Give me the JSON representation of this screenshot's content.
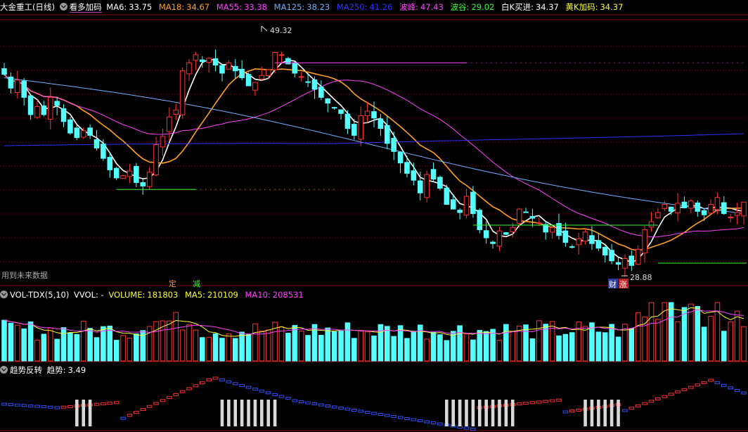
{
  "header": {
    "title": "大金重工(日线)",
    "indicator": "看多加码",
    "ma6_label": "MA6:",
    "ma6_value": "33.75",
    "ma18_label": "MA18:",
    "ma18_value": "34.67",
    "ma55_label": "MA55:",
    "ma55_value": "33.38",
    "ma125_label": "MA125:",
    "ma125_value": "38.23",
    "ma250_label": "MA250:",
    "ma250_value": "41.26",
    "peak_label": "波峰:",
    "peak_value": "47.43",
    "trough_label": "波谷:",
    "trough_value": "29.02",
    "white_k_label": "白K买进:",
    "white_k_value": "34.37",
    "yellow_k_label": "黄K加码:",
    "yellow_k_value": "34.37"
  },
  "main_panel": {
    "future_data_note": "用到未来数据",
    "high_label": "49.32",
    "low_label": "28.88",
    "tag_ding": "定",
    "tag_jian": "减",
    "tag_cai": "财",
    "tag_zhang": "涨"
  },
  "vol_header": {
    "name": "VOL-TDX(5,10)",
    "vvol": "VVOL: -",
    "volume_label": "VOLUME:",
    "volume_value": "181803",
    "ma5_label": "MA5:",
    "ma5_value": "210109",
    "ma10_label": "MA10:",
    "ma10_value": "208531"
  },
  "trend_header": {
    "name": "趋势反转",
    "trend_label": "趋势:",
    "trend_value": "3.49"
  },
  "colors": {
    "up": "#ff3232",
    "down": "#54ffff",
    "ma6": "#ffffff",
    "ma18": "#ffa020",
    "ma55": "#ff40ff",
    "ma125": "#70b0ff",
    "ma250": "#3030ff",
    "peak": "#ff40ff",
    "trough": "#30ff30",
    "white_k": "#ffffff",
    "yellow_k": "#ffff30"
  },
  "chart_data": [
    {
      "type": "candlestick",
      "title": "大金重工(日线)",
      "series_names": [
        "MA6",
        "MA18",
        "MA55",
        "MA125",
        "MA250"
      ],
      "price_range_approx": [
        28.88,
        49.32
      ],
      "annotations": [
        "49.32",
        "28.88",
        "用到未来数据",
        "定",
        "减",
        "财",
        "涨"
      ],
      "close_approx": [
        45.5,
        44.3,
        45.0,
        43.5,
        42.0,
        42.7,
        42.0,
        43.5,
        42.8,
        41.4,
        40.4,
        40.0,
        40.6,
        40.2,
        39.1,
        38.2,
        37.2,
        36.5,
        36.7,
        37.1,
        36.1,
        35.8,
        37.0,
        39.4,
        40.1,
        41.8,
        42.4,
        45.8,
        46.5,
        47.2,
        46.6,
        46.9,
        46.3,
        45.6,
        46.5,
        45.8,
        45.2,
        44.5,
        44.8,
        45.4,
        45.9,
        47.4,
        47.2,
        46.4,
        45.6,
        45.3,
        44.8,
        44.2,
        43.5,
        43.0,
        42.6,
        42.1,
        40.8,
        40.2,
        41.9,
        42.3,
        41.7,
        40.8,
        39.5,
        38.8,
        37.8,
        36.9,
        36.3,
        35.2,
        36.8,
        36.4,
        35.6,
        34.2,
        33.8,
        33.5,
        34.9,
        33.4,
        32.0,
        31.3,
        30.8,
        31.9,
        31.6,
        32.2,
        33.8,
        33.5,
        33.0,
        32.6,
        31.8,
        32.2,
        31.5,
        30.9,
        30.5,
        31.2,
        31.8,
        30.8,
        30.4,
        29.8,
        29.3,
        29.0,
        29.5,
        28.9,
        30.3,
        32.0,
        32.7,
        33.5,
        34.2,
        33.6,
        34.3,
        33.9,
        34.5,
        33.6,
        33.3,
        34.2,
        34.8,
        33.4,
        33.1,
        33.5,
        34.4
      ]
    },
    {
      "type": "bar",
      "title": "VOL-TDX(5,10)",
      "series_names": [
        "VOLUME",
        "MA5",
        "MA10"
      ],
      "last_values": {
        "VOLUME": 181803,
        "MA5": 210109,
        "MA10": 208531
      }
    },
    {
      "type": "bar",
      "title": "趋势反转",
      "last_values": {
        "趋势": 3.49
      }
    }
  ]
}
